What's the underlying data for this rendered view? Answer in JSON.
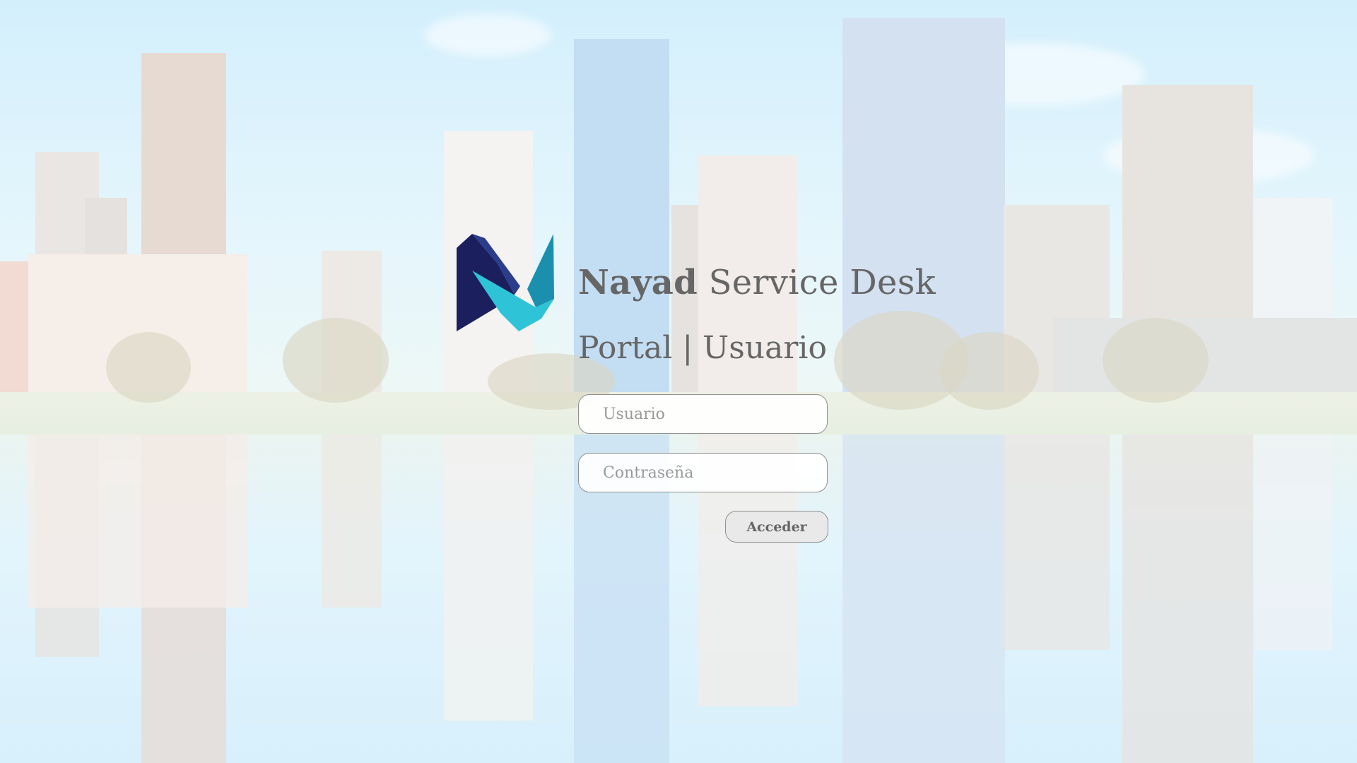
{
  "brand": {
    "name_bold": "Nayad",
    "name_rest": " Service Desk",
    "subtitle": "Portal | Usuario",
    "logo_icon": "nayad-logo-icon",
    "logo_colors": {
      "dark": "#1b1f5e",
      "mid": "#22357f",
      "teal": "#1a9bb4",
      "cyan": "#2fc3d8"
    }
  },
  "login": {
    "username_placeholder": "Usuario",
    "username_value": "",
    "password_placeholder": "Contraseña",
    "password_value": "",
    "submit_label": "Acceder"
  },
  "colors": {
    "text": "#666666",
    "field_border": "#8f8f8f",
    "button_bg": "#e9e9e9"
  }
}
